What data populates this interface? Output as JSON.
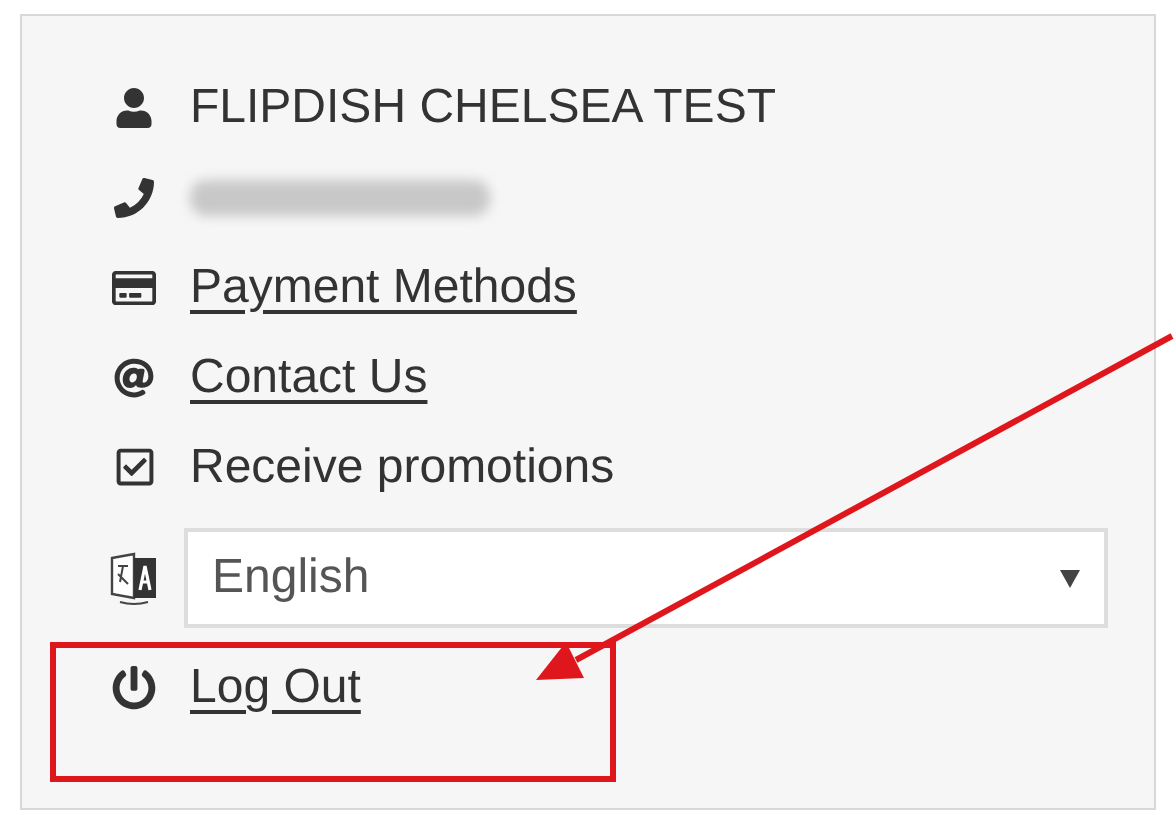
{
  "account": {
    "name": "FLIPDISH CHELSEA TEST",
    "phone": {
      "kind": "redacted"
    },
    "links": [
      {
        "kind": "card",
        "label": "Payment Methods"
      },
      {
        "kind": "at",
        "label": "Contact Us"
      }
    ],
    "promotions": {
      "label": "Receive promotions",
      "checked": true
    },
    "language": {
      "value": "English"
    },
    "logout": {
      "label": "Log Out"
    }
  }
}
